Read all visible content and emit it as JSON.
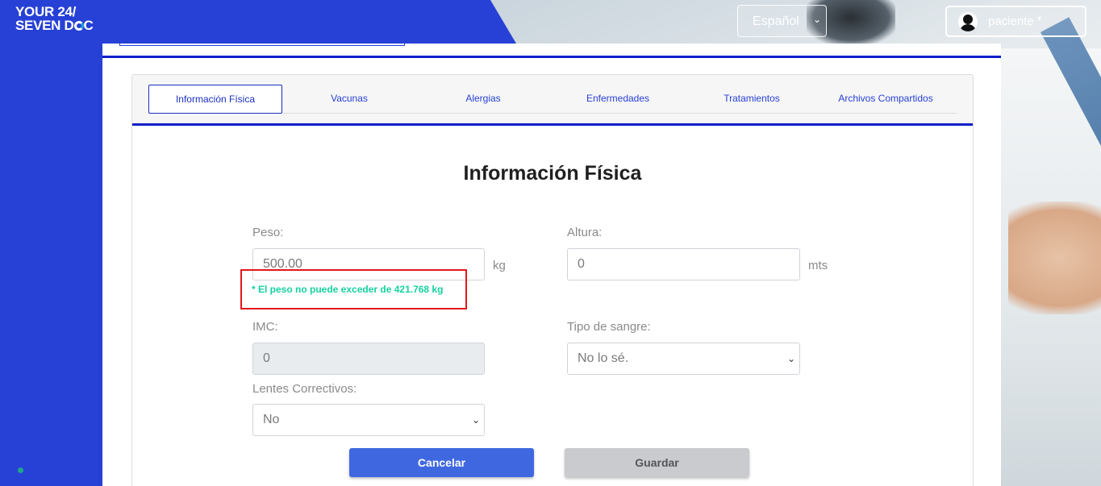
{
  "header": {
    "logo_line1": "YOUR 24/",
    "logo_line2_a": "SEVEN D",
    "logo_line2_b": "C",
    "language": {
      "selected": "Español",
      "icon": "chevron-down-icon"
    },
    "user": {
      "name": "paciente",
      "icon": "user-avatar-icon",
      "caret": "▾"
    }
  },
  "tabs": [
    {
      "label": "Información Física",
      "active": true
    },
    {
      "label": "Vacunas",
      "active": false
    },
    {
      "label": "Alergias",
      "active": false
    },
    {
      "label": "Enfermedades",
      "active": false
    },
    {
      "label": "Tratamientos",
      "active": false
    },
    {
      "label": "Archivos Compartidos",
      "active": false
    }
  ],
  "form": {
    "title": "Información Física",
    "peso": {
      "label": "Peso:",
      "value": "500.00",
      "unit": "kg",
      "error": "* El peso no puede exceder de 421.768 kg"
    },
    "altura": {
      "label": "Altura:",
      "value": "0",
      "unit": "mts"
    },
    "imc": {
      "label": "IMC:",
      "value": "0"
    },
    "tipo_sangre": {
      "label": "Tipo de sangre:",
      "selected": "No lo sé."
    },
    "lentes": {
      "label": "Lentes Correctivos:",
      "selected": "No"
    }
  },
  "buttons": {
    "cancel": "Cancelar",
    "save": "Guardar"
  },
  "colors": {
    "brand_blue": "#2741d6",
    "divider_blue": "#0b1fc8",
    "error_green": "#15d1a0",
    "highlight_red": "#e31818",
    "cancel_button": "#3f68e0",
    "save_button": "#c9cbcf"
  }
}
